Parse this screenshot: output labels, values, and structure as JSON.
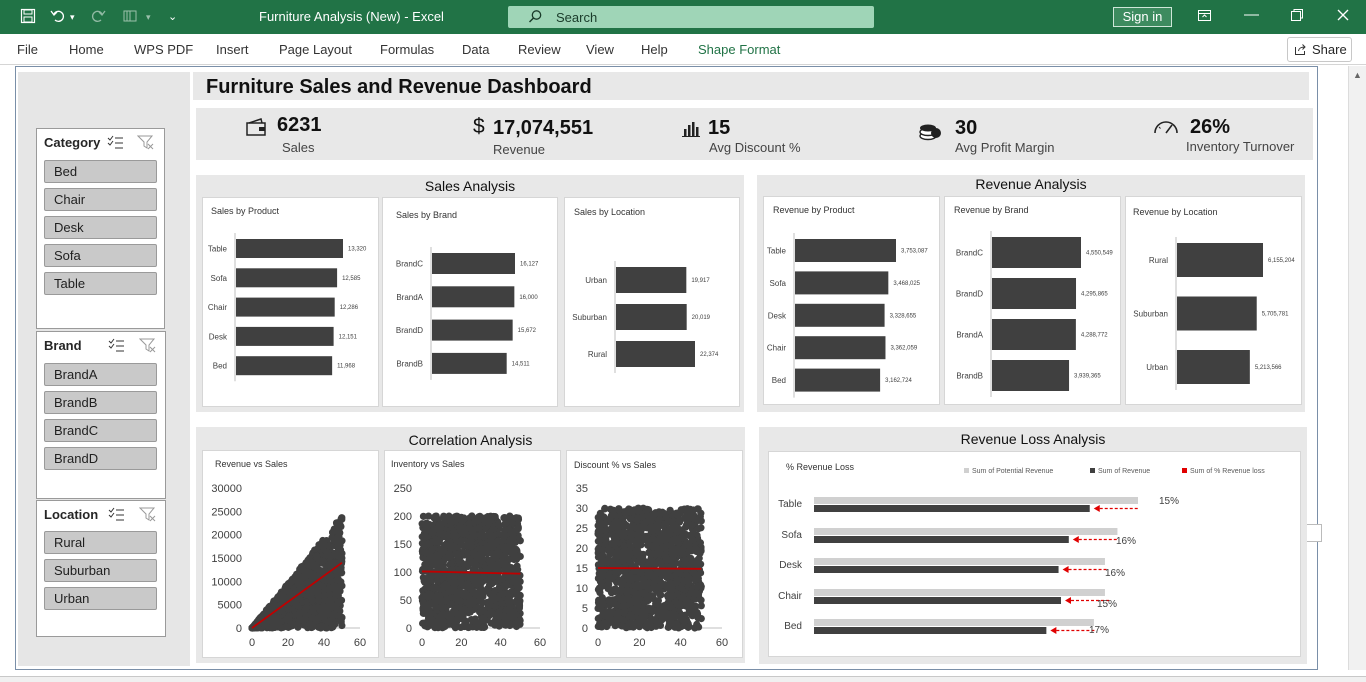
{
  "app": {
    "window_title": "Furniture Analysis (New)  -  Excel",
    "search_placeholder": "Search",
    "sign_in": "Sign in",
    "share": "Share"
  },
  "ribbon": {
    "tabs": [
      "File",
      "Home",
      "WPS PDF",
      "Insert",
      "Page Layout",
      "Formulas",
      "Data",
      "Review",
      "View",
      "Help",
      "Shape Format"
    ],
    "active_tab": "Shape Format"
  },
  "slicers": {
    "category": {
      "title": "Category",
      "items": [
        "Bed",
        "Chair",
        "Desk",
        "Sofa",
        "Table"
      ]
    },
    "brand": {
      "title": "Brand",
      "items": [
        "BrandA",
        "BrandB",
        "BrandC",
        "BrandD"
      ]
    },
    "location": {
      "title": "Location",
      "items": [
        "Rural",
        "Suburban",
        "Urban"
      ]
    }
  },
  "dashboard": {
    "title": "Furniture Sales and Revenue Dashboard",
    "kpis": [
      {
        "value": "6231",
        "label": "Sales",
        "icon": "wallet-icon"
      },
      {
        "value": "17,074,551",
        "label": "Revenue",
        "icon": "dollar-icon"
      },
      {
        "value": "15",
        "label": "Avg Discount %",
        "icon": "bar-chart-icon"
      },
      {
        "value": "30",
        "label": "Avg Profit Margin",
        "icon": "coins-icon"
      },
      {
        "value": "26%",
        "label": "Inventory Turnover",
        "icon": "gauge-icon"
      }
    ],
    "sections": {
      "sales": "Sales Analysis",
      "revenue": "Revenue Analysis",
      "correlation": "Correlation Analysis",
      "loss": "Revenue Loss Analysis"
    }
  },
  "colors": {
    "bar": "#404040",
    "accent": "#217346",
    "trend": "#c00000",
    "loss": "#e00000",
    "potential": "#d0d0d0"
  },
  "chart_data": [
    {
      "type": "bar",
      "title": "Sales by Product",
      "categories": [
        "Table",
        "Sofa",
        "Chair",
        "Desk",
        "Bed"
      ],
      "values": [
        13320,
        12585,
        12286,
        12151,
        11968
      ],
      "labels": [
        "13,320",
        "12,585",
        "12,286",
        "12,151",
        "11,968"
      ],
      "orientation": "horizontal"
    },
    {
      "type": "bar",
      "title": "Sales by Brand",
      "categories": [
        "BrandC",
        "BrandA",
        "BrandD",
        "BrandB"
      ],
      "values": [
        16127,
        16000,
        15672,
        14511
      ],
      "labels": [
        "16,127",
        "16,000",
        "15,672",
        "14,511"
      ],
      "orientation": "horizontal"
    },
    {
      "type": "bar",
      "title": "Sales by Location",
      "categories": [
        "Urban",
        "Suburban",
        "Rural"
      ],
      "values": [
        19917,
        20019,
        22374
      ],
      "labels": [
        "19,917",
        "20,019",
        "22,374"
      ],
      "orientation": "horizontal"
    },
    {
      "type": "bar",
      "title": "Revenue by Product",
      "categories": [
        "Table",
        "Sofa",
        "Desk",
        "Chair",
        "Bed"
      ],
      "values": [
        3753087,
        3468025,
        3328655,
        3362059,
        3162724
      ],
      "labels": [
        "3,753,087",
        "3,468,025",
        "3,328,655",
        "3,362,059",
        "3,162,724"
      ],
      "orientation": "horizontal"
    },
    {
      "type": "bar",
      "title": "Revenue by Brand",
      "categories": [
        "BrandC",
        "BrandD",
        "BrandA",
        "BrandB"
      ],
      "values": [
        4550549,
        4295865,
        4288772,
        3939365
      ],
      "labels": [
        "4,550,549",
        "4,295,865",
        "4,288,772",
        "3,939,365"
      ],
      "orientation": "horizontal"
    },
    {
      "type": "bar",
      "title": "Revenue by Location",
      "categories": [
        "Rural",
        "Suburban",
        "Urban"
      ],
      "values": [
        6155204,
        5705781,
        5213566
      ],
      "labels": [
        "6,155,204",
        "5,705,781",
        "5,213,566"
      ],
      "orientation": "horizontal"
    },
    {
      "type": "scatter",
      "title": "Revenue vs Sales",
      "xlim": [
        0,
        60
      ],
      "ylim": [
        0,
        30000
      ],
      "xticks": [
        "0",
        "20",
        "40",
        "60"
      ],
      "yticks": [
        "0",
        "5000",
        "10000",
        "15000",
        "20000",
        "25000",
        "30000"
      ],
      "point_range": {
        "x": [
          0,
          50
        ],
        "y_max_at_x": 24000
      },
      "trendline": [
        [
          0,
          0
        ],
        [
          50,
          14000
        ]
      ]
    },
    {
      "type": "scatter",
      "title": "Inventory vs Sales",
      "xlim": [
        0,
        60
      ],
      "ylim": [
        0,
        250
      ],
      "xticks": [
        "0",
        "20",
        "40",
        "60"
      ],
      "yticks": [
        "0",
        "50",
        "100",
        "150",
        "200",
        "250"
      ],
      "point_range": {
        "x": [
          0,
          50
        ],
        "y": [
          0,
          200
        ]
      },
      "trendline": [
        [
          0,
          101
        ],
        [
          50,
          97
        ]
      ]
    },
    {
      "type": "scatter",
      "title": "Discount % vs Sales",
      "xlim": [
        0,
        60
      ],
      "ylim": [
        0,
        35
      ],
      "xticks": [
        "0",
        "20",
        "40",
        "60"
      ],
      "yticks": [
        "0",
        "5",
        "10",
        "15",
        "20",
        "25",
        "30",
        "35"
      ],
      "point_range": {
        "x": [
          0,
          50
        ],
        "y": [
          0,
          30
        ]
      },
      "trendline": [
        [
          0,
          15
        ],
        [
          50,
          14.8
        ]
      ]
    },
    {
      "type": "bar",
      "title": "% Revenue Loss",
      "categories": [
        "Table",
        "Sofa",
        "Desk",
        "Chair",
        "Bed"
      ],
      "series": [
        {
          "name": "Sum of Potential Revenue",
          "values": [
            4410000,
            4130000,
            3960000,
            3960000,
            3810000
          ]
        },
        {
          "name": "Sum of Revenue",
          "values": [
            3753087,
            3468025,
            3328655,
            3362059,
            3162724
          ]
        },
        {
          "name": "Sum of % Revenue loss",
          "values": [
            15,
            16,
            16,
            15,
            17
          ]
        }
      ],
      "loss_labels": [
        "15%",
        "16%",
        "16%",
        "15%",
        "17%"
      ],
      "legend": "top"
    }
  ]
}
